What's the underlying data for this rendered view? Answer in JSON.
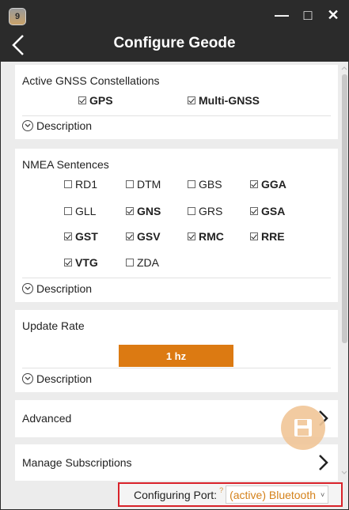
{
  "window": {
    "app_icon_label": "9",
    "title": "Configure Geode",
    "minimize_glyph": "—",
    "maximize_glyph": "□",
    "close_glyph": "✕"
  },
  "gnss": {
    "title": "Active GNSS Constellations",
    "items": [
      {
        "label": "GPS",
        "checked": true
      },
      {
        "label": "Multi-GNSS",
        "checked": true
      }
    ],
    "description_label": "Description"
  },
  "nmea": {
    "title": "NMEA Sentences",
    "items": [
      {
        "label": "RD1",
        "checked": false
      },
      {
        "label": "DTM",
        "checked": false
      },
      {
        "label": "GBS",
        "checked": false
      },
      {
        "label": "GGA",
        "checked": true
      },
      {
        "label": "GLL",
        "checked": false
      },
      {
        "label": "GNS",
        "checked": true
      },
      {
        "label": "GRS",
        "checked": false
      },
      {
        "label": "GSA",
        "checked": true
      },
      {
        "label": "GST",
        "checked": true
      },
      {
        "label": "GSV",
        "checked": true
      },
      {
        "label": "RMC",
        "checked": true
      },
      {
        "label": "RRE",
        "checked": true
      },
      {
        "label": "VTG",
        "checked": true
      },
      {
        "label": "ZDA",
        "checked": false
      }
    ],
    "description_label": "Description"
  },
  "update_rate": {
    "title": "Update Rate",
    "value": "1 hz",
    "description_label": "Description"
  },
  "advanced": {
    "label": "Advanced"
  },
  "subscriptions": {
    "label": "Manage Subscriptions"
  },
  "port": {
    "label": "Configuring Port:",
    "help_glyph": "?",
    "value": "(active) Bluetooth",
    "caret_glyph": "˅"
  },
  "colors": {
    "titlebar": "#2b2b2b",
    "accent_orange": "#dc7a12",
    "fab": "#f1c79a",
    "highlight_border": "#d9222a"
  },
  "icons": {
    "back": "chevron-left-icon",
    "fab": "save-icon",
    "row": "chevron-right-icon"
  }
}
